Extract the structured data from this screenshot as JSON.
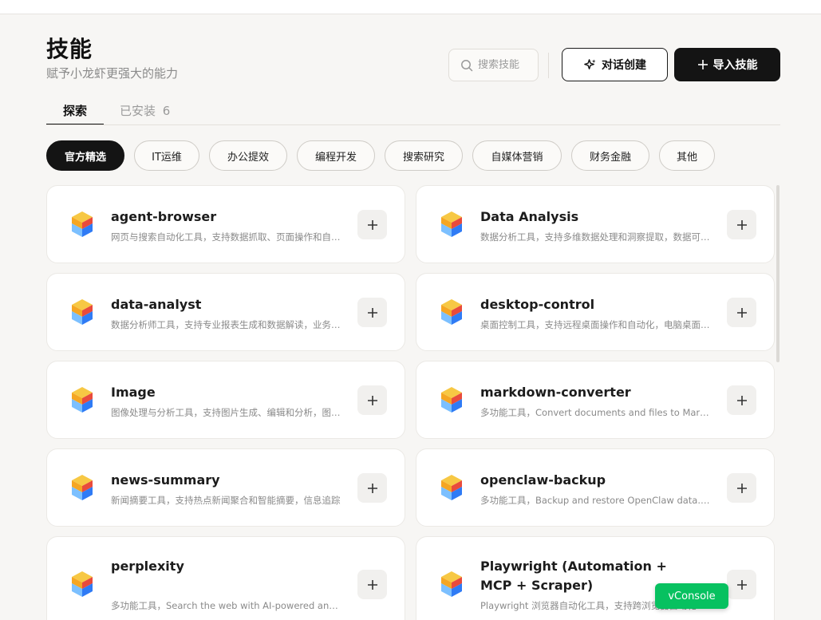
{
  "header": {
    "title": "技能",
    "subtitle": "赋予小龙虾更强大的能力"
  },
  "search": {
    "placeholder": "搜索技能",
    "icon": "search-icon"
  },
  "actions": {
    "chat_create_label": "对话创建",
    "chat_create_icon": "sparkle-icon",
    "import_label": "导入技能",
    "import_icon": "plus-icon"
  },
  "tabs": [
    {
      "label": "探索",
      "active": true
    },
    {
      "label": "已安装",
      "count": "6",
      "active": false
    }
  ],
  "categories": [
    {
      "label": "官方精选",
      "active": true
    },
    {
      "label": "IT运维"
    },
    {
      "label": "办公提效"
    },
    {
      "label": "编程开发"
    },
    {
      "label": "搜索研究"
    },
    {
      "label": "自媒体营销"
    },
    {
      "label": "财务金融"
    },
    {
      "label": "其他"
    }
  ],
  "skills": [
    {
      "name": "agent-browser",
      "desc": "网页与搜索自动化工具，支持数据抓取、页面操作和自动化测试"
    },
    {
      "name": "Data Analysis",
      "desc": "数据分析工具，支持多维数据处理和洞察提取，数据可视化"
    },
    {
      "name": "data-analyst",
      "desc": "数据分析师工具，支持专业报表生成和数据解读，业务分析"
    },
    {
      "name": "desktop-control",
      "desc": "桌面控制工具，支持远程桌面操作和自动化，电脑桌面管理"
    },
    {
      "name": "Image",
      "desc": "图像处理与分析工具，支持图片生成、编辑和分析，图像识别"
    },
    {
      "name": "markdown-converter",
      "desc": "多功能工具，Convert documents and files to Markdown"
    },
    {
      "name": "news-summary",
      "desc": "新闻摘要工具，支持热点新闻聚合和智能摘要，信息追踪"
    },
    {
      "name": "openclaw-backup",
      "desc": "多功能工具，Backup and restore OpenClaw data. Use when"
    },
    {
      "name": "perplexity",
      "desc": "多功能工具，Search the web with AI-powered answers"
    },
    {
      "name": "Playwright (Automation + MCP + Scraper)",
      "desc": "Playwright 浏览器自动化工具，支持跨浏览器自动化测试"
    }
  ],
  "card_action_icon": "plus-icon",
  "card_logo_icon": "skill-cube-icon",
  "vconsole_label": "vConsole",
  "colors": {
    "accent_dark": "#141414",
    "background": "#f7f6f4",
    "vconsole": "#07c160",
    "logo_orange": "#f5a623",
    "logo_red": "#e94b3c",
    "logo_blue": "#2f7bf5"
  }
}
